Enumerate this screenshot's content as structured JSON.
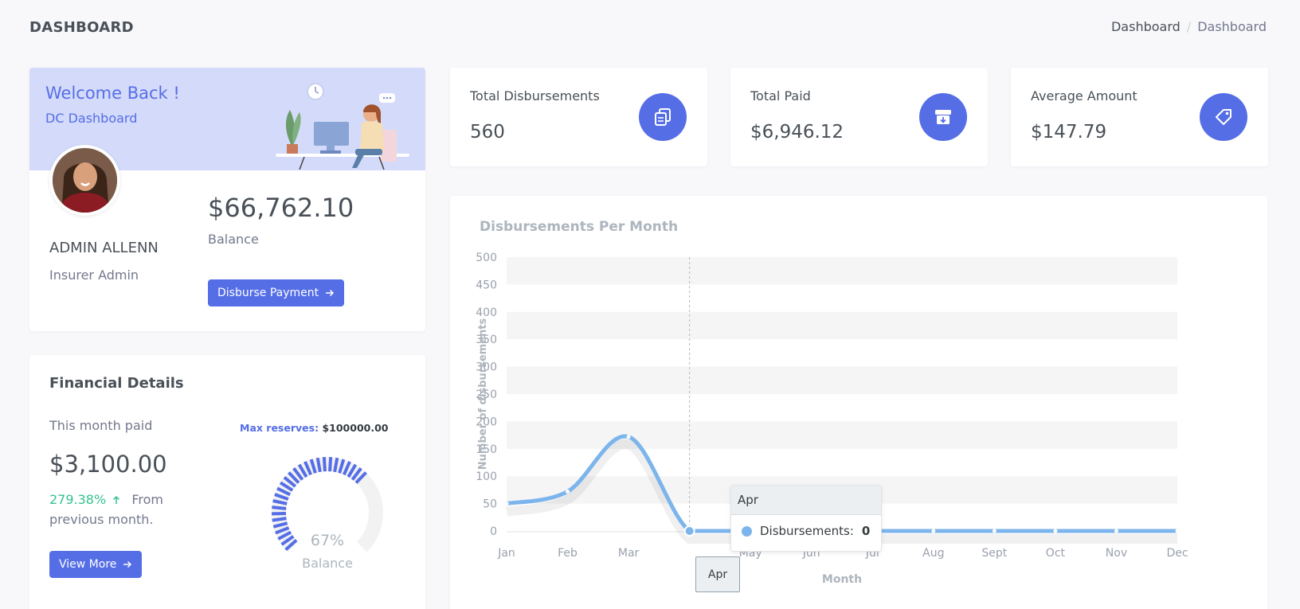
{
  "page": {
    "title": "DASHBOARD"
  },
  "breadcrumb": {
    "items": [
      "Dashboard",
      "Dashboard"
    ],
    "separator": "/"
  },
  "welcome": {
    "title": "Welcome Back !",
    "subtitle": "DC Dashboard",
    "user_name": "ADMIN ALLENN",
    "user_role": "Insurer Admin",
    "balance_amount": "$66,762.10",
    "balance_label": "Balance",
    "disburse_button": "Disburse Payment"
  },
  "financial": {
    "title": "Financial Details",
    "month_label": "This month paid",
    "amount": "$3,100.00",
    "change_pct": "279.38%",
    "change_text": "From previous month.",
    "view_more_button": "View More",
    "max_reserves_label": "Max reserves:",
    "max_reserves_value": "$100000.00",
    "gauge_percent": "67%",
    "gauge_value": 0.67,
    "gauge_label": "Balance"
  },
  "stats": [
    {
      "label": "Total Disbursements",
      "value": "560",
      "icon": "copy-icon"
    },
    {
      "label": "Total Paid",
      "value": "$6,946.12",
      "icon": "archive-icon"
    },
    {
      "label": "Average Amount",
      "value": "$147.79",
      "icon": "tag-icon"
    }
  ],
  "colors": {
    "primary": "#556ee6",
    "success": "#34c38f",
    "series": "#7cb5ec",
    "band": "#d4daf9"
  },
  "chart_data": {
    "type": "area",
    "title": "Disbursements Per Month",
    "xlabel": "Month",
    "ylabel": "Number of disbursements",
    "categories": [
      "Jan",
      "Feb",
      "Mar",
      "Apr",
      "May",
      "Jun",
      "Jul",
      "Aug",
      "Sept",
      "Oct",
      "Nov",
      "Dec"
    ],
    "series": [
      {
        "name": "Disbursements",
        "values": [
          50,
          72,
          172,
          0,
          0,
          0,
          0,
          0,
          0,
          0,
          0,
          0
        ]
      }
    ],
    "ylim": [
      0,
      500
    ],
    "yticks": [
      0,
      50,
      100,
      150,
      200,
      250,
      300,
      350,
      400,
      450,
      500
    ],
    "tooltip": {
      "category": "Apr",
      "series": "Disbursements:",
      "value": "0"
    }
  }
}
